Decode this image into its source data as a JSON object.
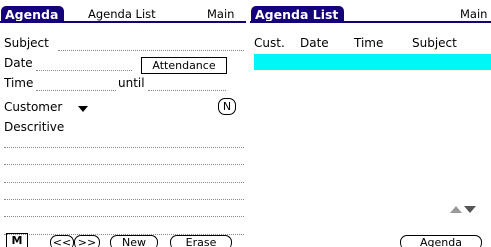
{
  "colors": {
    "accent": "#14007a",
    "highlight": "#00f7f7"
  },
  "left": {
    "tab_title": "Agenda",
    "menu_list": "Agenda List",
    "menu_main": "Main",
    "fields": {
      "subject_label": "Subject",
      "date_label": "Date",
      "attendance_button": "Attendance",
      "time_label": "Time",
      "until_label": "until",
      "customer_label": "Customer",
      "customer_icon": "chevron-down-icon",
      "n_button": "N",
      "descriptive_label": "Descritive"
    },
    "footer": {
      "m_button": "M",
      "prev_button": "<<",
      "next_button": ">>",
      "new_button": "New",
      "erase_button": "Erase"
    }
  },
  "right": {
    "tab_title": "Agenda List",
    "menu_main": "Main",
    "columns": [
      "Cust.",
      "Date",
      "Time",
      "Subject"
    ],
    "selected_row_color": "#00f7f7",
    "scroll_icons": [
      "scroll-up-icon",
      "scroll-down-icon"
    ],
    "agenda_button": "Agenda"
  }
}
